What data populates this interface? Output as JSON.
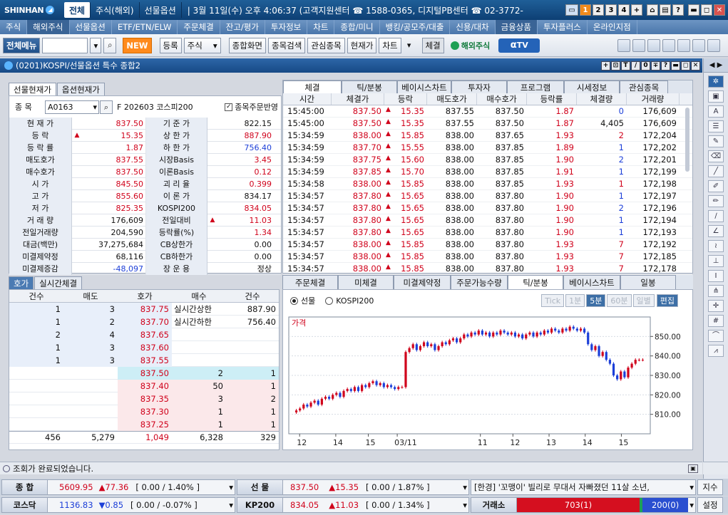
{
  "titlebar": {
    "brand": "SHINHAN",
    "tabs": [
      "전체",
      "주식(해외)",
      "선물옵션"
    ],
    "text": "| 3월 11일(수) 오후 4:06:37 (고객지원센터 ☎ 1588-0365, 디지털PB센터 ☎ 02-3772-",
    "page_buttons": [
      "1",
      "2",
      "3",
      "4",
      "+"
    ],
    "window_buttons": [
      "⌂",
      "▤",
      "?",
      "▬",
      "◻",
      "✕"
    ]
  },
  "menu": [
    "주식",
    "해외주식",
    "선물옵션",
    "ETF/ETN/ELW",
    "주문체결",
    "잔고/평가",
    "투자정보",
    "차트",
    "종합/미니",
    "뱅킹/공모주/대출",
    "신용/대차",
    "금융상품",
    "투자플러스",
    "온라인지점"
  ],
  "toolbar": {
    "all_menu": "전체메뉴",
    "new_label": "NEW",
    "register": "등록",
    "category": "주식",
    "buttons": [
      "종합화면",
      "종목검색",
      "관심종목",
      "현재가",
      "차트"
    ],
    "settle": "체결",
    "overseas": "해외주식",
    "tv": "TV"
  },
  "window": {
    "title": "(0201)KOSPI/선물옵션 특수 종합2",
    "controls": [
      "+",
      "⊡",
      "T",
      "∕",
      "0",
      "∓",
      "?",
      "▬",
      "◻",
      "✕"
    ]
  },
  "left": {
    "tabs": [
      "선물현재가",
      "옵션현재가"
    ],
    "code_label": "종 목",
    "code": "A0163",
    "name": "F 202603 코스피200",
    "checkbox": "종목주문반영",
    "rows": [
      {
        "l1": "현 재 가",
        "v1": "837.50",
        "c1": "red",
        "l2": "기 준 가",
        "v2": "822.15",
        "c2": ""
      },
      {
        "l1": "등 락",
        "v1": "15.35",
        "c1": "red",
        "arrow": true,
        "l2": "상 한 가",
        "v2": "887.90",
        "c2": "red"
      },
      {
        "l1": "등 락 률",
        "v1": "1.87",
        "c1": "red",
        "l2": "하 한 가",
        "v2": "756.40",
        "c2": "blue"
      },
      {
        "l1": "매도호가",
        "v1": "837.55",
        "c1": "red",
        "l2": "시장Basis",
        "v2": "3.45",
        "c2": "red"
      },
      {
        "l1": "매수호가",
        "v1": "837.50",
        "c1": "red",
        "l2": "이론Basis",
        "v2": "0.12",
        "c2": "red"
      },
      {
        "l1": "시 가",
        "v1": "845.50",
        "c1": "red",
        "l2": "괴 리 율",
        "v2": "0.399",
        "c2": "red"
      },
      {
        "l1": "고 가",
        "v1": "855.60",
        "c1": "red",
        "l2": "이 론 가",
        "v2": "834.17",
        "c2": ""
      },
      {
        "l1": "저 가",
        "v1": "825.35",
        "c1": "red",
        "l2": "KOSPI200",
        "v2": "834.05",
        "c2": "red"
      },
      {
        "l1": "거 래 량",
        "v1": "176,609",
        "c1": "",
        "l2": "전일대비",
        "v2": "11.03",
        "c2": "red",
        "arrow2": true
      },
      {
        "l1": "전일거래량",
        "v1": "204,590",
        "c1": "",
        "l2": "등락률(%)",
        "v2": "1.34",
        "c2": "red"
      },
      {
        "l1": "대금(백만)",
        "v1": "37,275,684",
        "c1": "",
        "l2": "CB상한가",
        "v2": "0.00",
        "c2": ""
      },
      {
        "l1": "미결제약정",
        "v1": "68,116",
        "c1": "",
        "l2": "CB하한가",
        "v2": "0.00",
        "c2": ""
      },
      {
        "l1": "미결제증감",
        "v1": "-48,097",
        "c1": "blue",
        "l2": "장 운 용",
        "v2": "정상",
        "c2": ""
      }
    ]
  },
  "ticks": {
    "tabs": [
      "체결",
      "틱/분봉",
      "베이시스차트",
      "투자자",
      "프로그램",
      "시세정보",
      "관심종목"
    ],
    "headers": [
      "시간",
      "체결가",
      "등락",
      "매도호가",
      "매수호가",
      "등락률",
      "체결량",
      "거래량"
    ],
    "rows": [
      [
        "15:45:00",
        "837.50",
        "15.35",
        "837.55",
        "837.50",
        "1.87",
        "0",
        "176,609",
        "blue"
      ],
      [
        "15:45:00",
        "837.50",
        "15.35",
        "837.55",
        "837.50",
        "1.87",
        "4,405",
        "176,609",
        "black"
      ],
      [
        "15:34:59",
        "838.00",
        "15.85",
        "838.00",
        "837.65",
        "1.93",
        "2",
        "172,204",
        "red"
      ],
      [
        "15:34:59",
        "837.70",
        "15.55",
        "838.00",
        "837.85",
        "1.89",
        "1",
        "172,202",
        "blue"
      ],
      [
        "15:34:59",
        "837.75",
        "15.60",
        "838.00",
        "837.85",
        "1.90",
        "2",
        "172,201",
        "blue"
      ],
      [
        "15:34:59",
        "837.85",
        "15.70",
        "838.00",
        "837.85",
        "1.91",
        "1",
        "172,199",
        "blue"
      ],
      [
        "15:34:58",
        "838.00",
        "15.85",
        "838.00",
        "837.85",
        "1.93",
        "1",
        "172,198",
        "red"
      ],
      [
        "15:34:57",
        "837.80",
        "15.65",
        "838.00",
        "837.80",
        "1.90",
        "1",
        "172,197",
        "blue"
      ],
      [
        "15:34:57",
        "837.80",
        "15.65",
        "838.00",
        "837.80",
        "1.90",
        "2",
        "172,196",
        "blue"
      ],
      [
        "15:34:57",
        "837.80",
        "15.65",
        "838.00",
        "837.80",
        "1.90",
        "1",
        "172,194",
        "blue"
      ],
      [
        "15:34:57",
        "837.80",
        "15.65",
        "838.00",
        "837.80",
        "1.90",
        "1",
        "172,193",
        "blue"
      ],
      [
        "15:34:57",
        "838.00",
        "15.85",
        "838.00",
        "837.80",
        "1.93",
        "7",
        "172,192",
        "red"
      ],
      [
        "15:34:57",
        "838.00",
        "15.85",
        "838.00",
        "837.80",
        "1.93",
        "7",
        "172,185",
        "red"
      ],
      [
        "15:34:57",
        "838.00",
        "15.85",
        "838.00",
        "837.80",
        "1.93",
        "7",
        "172,178",
        "red"
      ]
    ]
  },
  "hoga": {
    "tabs": [
      "호가",
      "실시간체결"
    ],
    "headers": [
      "건수",
      "매도",
      "호가",
      "매수",
      "건수"
    ],
    "asks": [
      [
        "1",
        "3",
        "837.75"
      ],
      [
        "1",
        "2",
        "837.70"
      ],
      [
        "2",
        "4",
        "837.65"
      ],
      [
        "1",
        "3",
        "837.60"
      ],
      [
        "1",
        "3",
        "837.55"
      ]
    ],
    "limit_up_label": "실시간상한",
    "limit_up": "887.90",
    "limit_down_label": "실시간하한",
    "limit_down": "756.40",
    "bids": [
      [
        "837.50",
        "2",
        "1"
      ],
      [
        "837.40",
        "50",
        "1"
      ],
      [
        "837.35",
        "3",
        "2"
      ],
      [
        "837.30",
        "1",
        "1"
      ],
      [
        "837.25",
        "1",
        "1"
      ]
    ],
    "totals": [
      "456",
      "5,279",
      "1,049",
      "6,328",
      "329"
    ]
  },
  "chartpanel": {
    "tabs": [
      "주문체결",
      "미체결",
      "미결제약정",
      "주문가능수량",
      "틱/분봉",
      "베이시스차트",
      "일봉"
    ],
    "radio1": "선물",
    "radio2": "KOSPI200",
    "buttons": [
      "Tick",
      "1분",
      "5분",
      "60분",
      "일별",
      "편집"
    ],
    "price_label": "가격"
  },
  "chart_data": {
    "type": "candlestick",
    "title": "",
    "ylabel": "가격",
    "ylim": [
      800,
      860
    ],
    "yticks": [
      "850.00",
      "840.00",
      "830.00",
      "820.00",
      "810.00"
    ],
    "xticks": [
      "12",
      "14",
      "15",
      "03/11",
      "11",
      "12",
      "13",
      "14",
      "15"
    ],
    "close": [
      812,
      813,
      815,
      814,
      816,
      817,
      815,
      818,
      819,
      818,
      820,
      821,
      819,
      822,
      823,
      822,
      824,
      822,
      825,
      824,
      826,
      827,
      825,
      826,
      824,
      825,
      824,
      823,
      824,
      824,
      842,
      844,
      846,
      843,
      845,
      847,
      845,
      846,
      843,
      845,
      847,
      846,
      848,
      849,
      847,
      849,
      851,
      850,
      852,
      851,
      853,
      851,
      852,
      850,
      852,
      851,
      853,
      852,
      851,
      852,
      850,
      851,
      849,
      851,
      852,
      850,
      852,
      851,
      853,
      852,
      854,
      853,
      852,
      854,
      853,
      855,
      854,
      853,
      854,
      852,
      846,
      843,
      845,
      840,
      842,
      838,
      836,
      830,
      828,
      832,
      829,
      834,
      836,
      838,
      838,
      838
    ]
  },
  "status": "조회가 완료되었습니다.",
  "tickers": {
    "t1_label": "종 합",
    "t1_val": "5609.95",
    "t1_chg": "▲77.36",
    "t1_box": "[ 0.00 / 1.40% ]",
    "t2_label": "선 물",
    "t2_val": "837.50",
    "t2_chg": "▲15.35",
    "t2_box": "[ 0.00 / 1.87% ]",
    "news": "[한경] '꼬맹이' 빌리로 무대서 자빠졌던 11살 소년,",
    "jisu": "지수",
    "t3_label": "코스닥",
    "t3_val": "1136.83",
    "t3_chg": "▼0.85",
    "t3_box": "[ 0.00 / -0.07% ]",
    "t4_label": "KP200",
    "t4_val": "834.05",
    "t4_chg": "▲11.03",
    "t4_box": "[ 0.00 / 1.34% ]",
    "exchange_label": "거래소",
    "exchange_up": "703(1)",
    "exchange_down": "200(0)",
    "settings": "설정"
  }
}
